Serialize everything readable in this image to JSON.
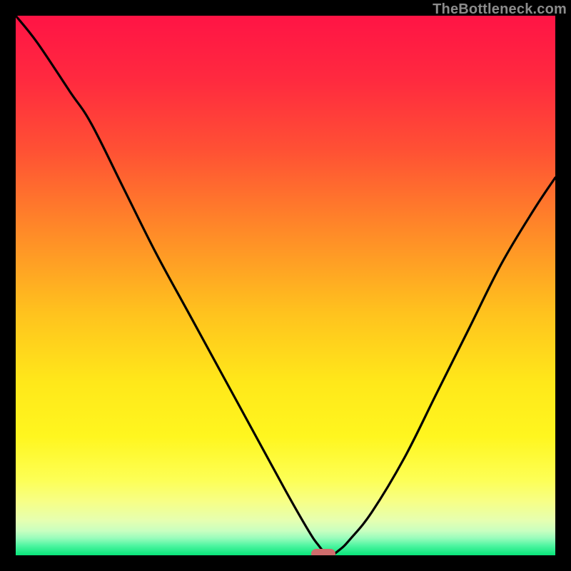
{
  "watermark": "TheBottleneck.com",
  "chart_data": {
    "type": "line",
    "title": "",
    "xlabel": "",
    "ylabel": "",
    "xlim": [
      0,
      100
    ],
    "ylim": [
      0,
      100
    ],
    "grid": false,
    "series": [
      {
        "name": "bottleneck-curve",
        "x": [
          0,
          4,
          10,
          14,
          20,
          26,
          32,
          38,
          44,
          50,
          54,
          56,
          58,
          60,
          62,
          66,
          72,
          78,
          84,
          90,
          96,
          100
        ],
        "values": [
          100,
          95,
          86,
          80,
          68,
          56,
          45,
          34,
          23,
          12,
          5,
          2,
          0,
          1,
          3,
          8,
          18,
          30,
          42,
          54,
          64,
          70
        ]
      }
    ],
    "marker": {
      "x": 57,
      "y": 0,
      "shape": "pill",
      "color": "#cf6d6d"
    },
    "gradient_stops": [
      {
        "pos": 0.0,
        "color": "#ff1445"
      },
      {
        "pos": 0.12,
        "color": "#ff2a3f"
      },
      {
        "pos": 0.25,
        "color": "#ff5134"
      },
      {
        "pos": 0.4,
        "color": "#ff8a28"
      },
      {
        "pos": 0.55,
        "color": "#ffc21e"
      },
      {
        "pos": 0.68,
        "color": "#ffe81a"
      },
      {
        "pos": 0.78,
        "color": "#fff61f"
      },
      {
        "pos": 0.86,
        "color": "#fdff55"
      },
      {
        "pos": 0.9,
        "color": "#f7ff86"
      },
      {
        "pos": 0.935,
        "color": "#e6ffb0"
      },
      {
        "pos": 0.955,
        "color": "#c8ffc0"
      },
      {
        "pos": 0.968,
        "color": "#9afcbc"
      },
      {
        "pos": 0.982,
        "color": "#4ff5a1"
      },
      {
        "pos": 1.0,
        "color": "#08e57a"
      }
    ]
  }
}
